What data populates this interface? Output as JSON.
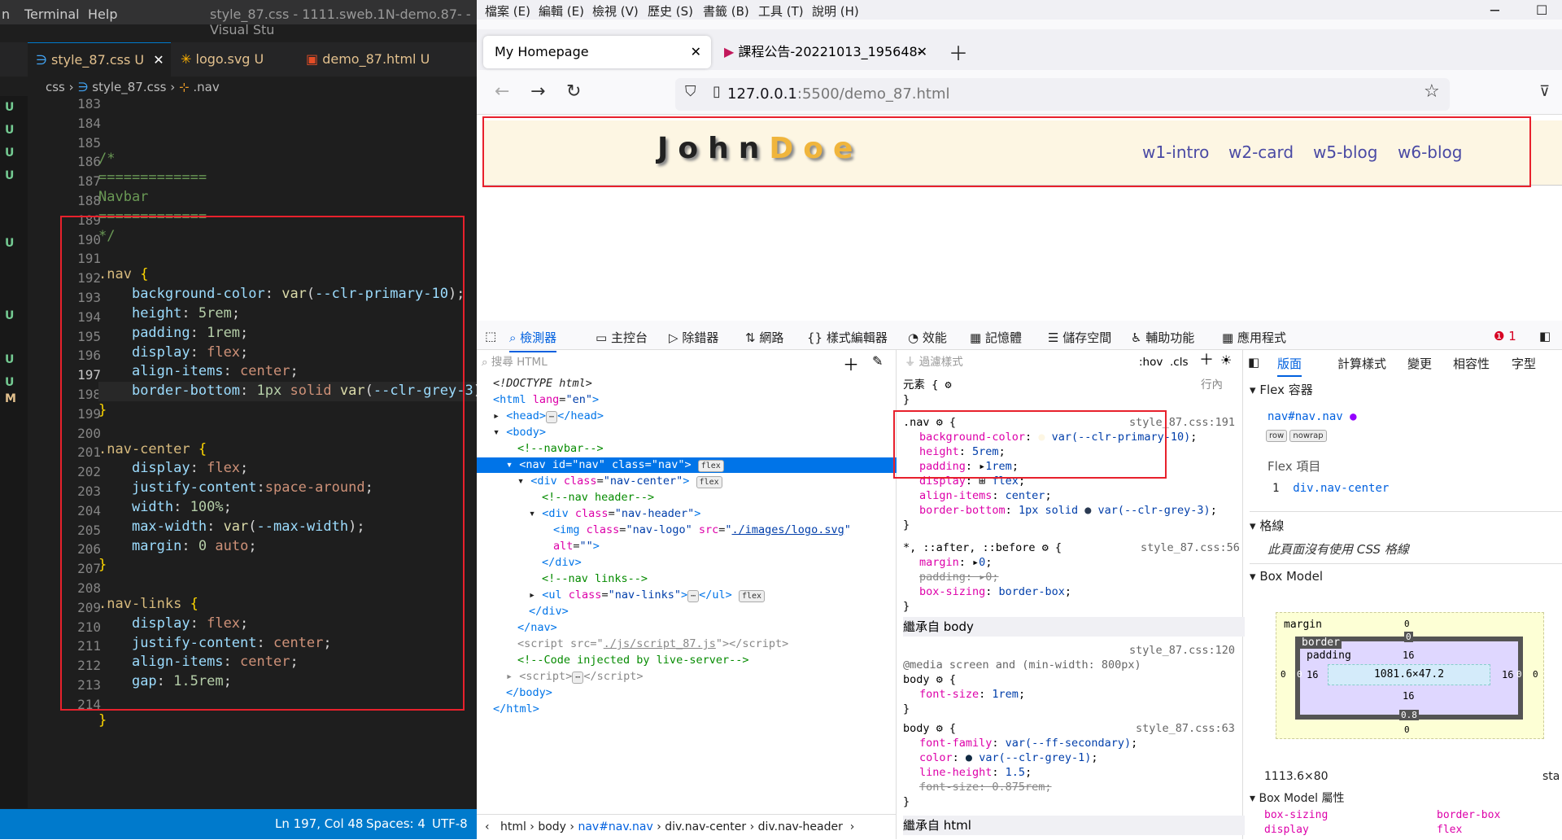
{
  "vscode": {
    "menu": [
      "n",
      "Terminal",
      "Help"
    ],
    "window_title": "style_87.css - 1111.sweb.1N-demo.87- - Visual Stu",
    "tabs": [
      {
        "name": "style_87.css",
        "status": "U",
        "active": true,
        "icon": "css-file-icon"
      },
      {
        "name": "logo.svg",
        "status": "U",
        "active": false,
        "icon": "svg-file-icon"
      },
      {
        "name": "demo_87.html",
        "status": "U",
        "active": false,
        "icon": "html-file-icon"
      }
    ],
    "breadcrumb": [
      "css",
      "style_87.css",
      ".nav"
    ],
    "scm_markers": [
      "U",
      "U",
      "U",
      "U",
      "U",
      "U",
      "U",
      "U",
      "M"
    ],
    "line_numbers": [
      "183",
      "184",
      "185",
      "186",
      "187",
      "188",
      "189",
      "190",
      "191",
      "192",
      "193",
      "194",
      "195",
      "196",
      "197",
      "198",
      "199",
      "200",
      "201",
      "202",
      "203",
      "204",
      "205",
      "206",
      "207",
      "208",
      "209",
      "210",
      "211",
      "212",
      "213",
      "214"
    ],
    "current_line": "197",
    "status": {
      "position": "Ln 197, Col 48",
      "spaces": "Spaces: 4",
      "encoding": "UTF-8"
    }
  },
  "firefox": {
    "menu": [
      "檔案 (E)",
      "編輯 (E)",
      "檢視 (V)",
      "歷史 (S)",
      "書籤 (B)",
      "工具 (T)",
      "說明 (H)"
    ],
    "tabs": [
      {
        "title": "My Homepage",
        "active": true
      },
      {
        "title": "課程公告-20221013_195648-",
        "active": false
      }
    ],
    "url_host": "127.0.0.1",
    "url_rest": ":5500/demo_87.html",
    "page": {
      "logo_a": "John",
      "logo_b": "Doe",
      "links": [
        "w1-intro",
        "w2-card",
        "w5-blog",
        "w6-blog"
      ]
    },
    "devtools": {
      "tabs": [
        "檢測器",
        "主控台",
        "除錯器",
        "網路",
        "樣式編輯器",
        "效能",
        "記憶體",
        "儲存空間",
        "輔助功能",
        "應用程式"
      ],
      "error_count": "1",
      "search_placeholder": "搜尋 HTML",
      "filter_placeholder": "過濾樣式",
      "hov": ":hov",
      "cls": ".cls",
      "layout_tabs": [
        "版面",
        "計算樣式",
        "變更",
        "相容性",
        "字型"
      ],
      "breadcrumb": [
        "html",
        "body",
        "nav#nav.nav",
        "div.nav-center",
        "div.nav-header"
      ],
      "element_label": "元素 {",
      "inline_label": "行內",
      "rule_nav_source": "style_87.css:191",
      "rule_star_source": "style_87.css:56",
      "inherited_body": "繼承自 body",
      "rule_body1_source": "style_87.css:120",
      "media": "@media screen and (min-width: 800px)",
      "rule_body2_source": "style_87.css:63",
      "inherited_html": "繼承自 html",
      "flex_container": "Flex 容器",
      "flex_target": "nav#nav.nav",
      "flex_items": "Flex 項目",
      "flex_item": "div.nav-center",
      "flex_item_count": "1",
      "grid": "格線",
      "grid_none": "此頁面沒有使用 CSS 格線",
      "box_model": "Box Model",
      "box": {
        "margin": "margin",
        "border": "border",
        "padding": "padding",
        "content": "1081.6×47.2",
        "pad_val": "16",
        "zero": "0",
        "border_bottom": "0.8"
      },
      "size": "1113.6×80",
      "sta": "sta",
      "box_props": "Box Model 屬性",
      "box_sizing": "box-sizing",
      "box_sizing_val": "border-box",
      "display": "display",
      "display_val": "flex"
    }
  }
}
